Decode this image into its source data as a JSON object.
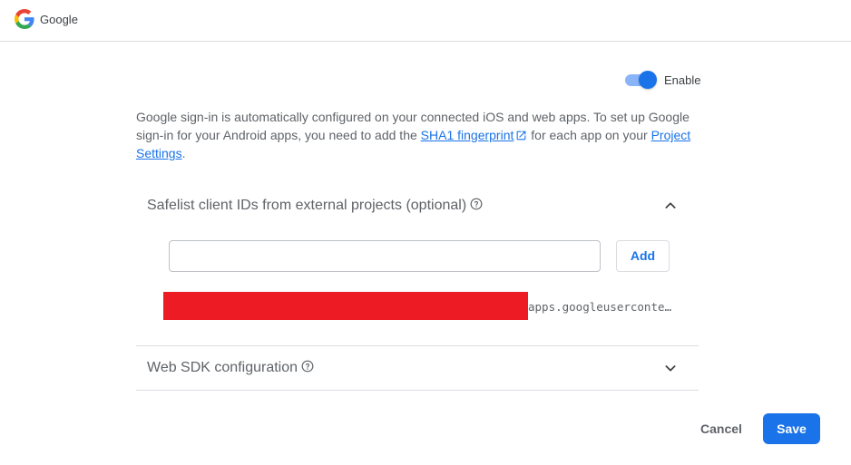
{
  "header": {
    "title": "Google",
    "logo_icon": "google-logo"
  },
  "toggle": {
    "label": "Enable",
    "checked": true,
    "accent": "#1a73e8"
  },
  "description": {
    "part1": "Google sign-in is automatically configured on your connected iOS and web apps. To set up Google sign-in for your Android apps, you need to add the ",
    "link1": "SHA1 fingerprint",
    "part2": " for each app on your ",
    "link2": "Project Settings",
    "part3": "."
  },
  "safelist": {
    "title": "Safelist client IDs from external projects (optional)",
    "input_value": "",
    "add_label": "Add",
    "client_id_suffix": "apps.googleusercontent.com",
    "expanded": true
  },
  "web_sdk": {
    "title": "Web SDK configuration",
    "expanded": false
  },
  "footer": {
    "cancel_label": "Cancel",
    "save_label": "Save"
  }
}
